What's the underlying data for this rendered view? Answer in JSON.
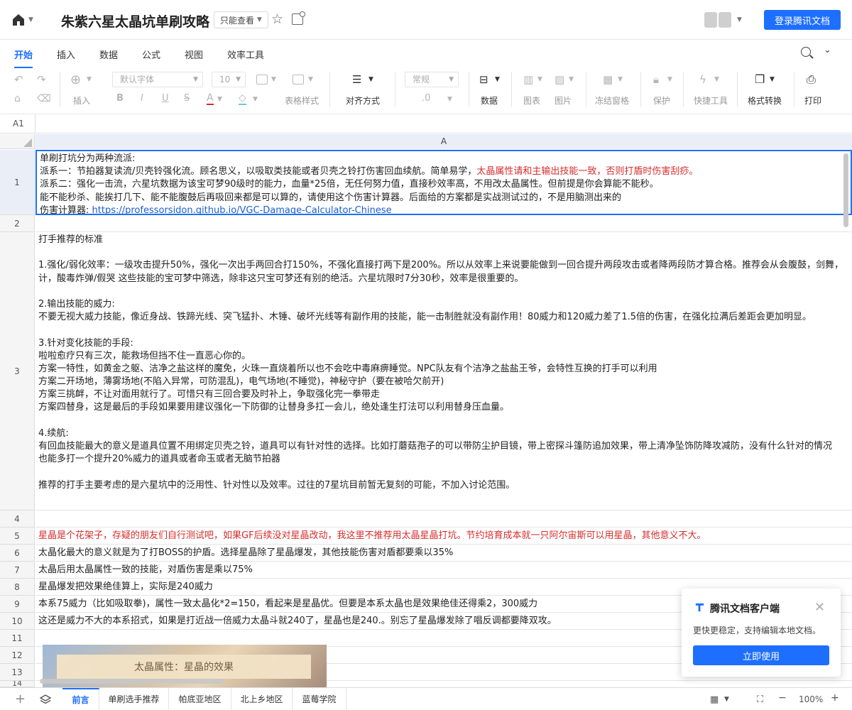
{
  "header": {
    "title": "朱紫六星太晶坑单刷攻略",
    "permission": "只能查看",
    "login_label": "登录腾讯文档"
  },
  "menu": {
    "tabs": [
      "开始",
      "插入",
      "数据",
      "公式",
      "视图",
      "效率工具"
    ]
  },
  "toolbar": {
    "font_family": "默认字体",
    "font_size": "10",
    "number_format": "常规",
    "decimal": ".0",
    "labels": {
      "insert": "插入",
      "table_style": "表格样式",
      "align": "对齐方式",
      "data": "数据",
      "chart": "图表",
      "image": "图片",
      "freeze": "冻结窗格",
      "protect": "保护",
      "quick_tools": "快捷工具",
      "format_convert": "格式转换",
      "print": "打印"
    }
  },
  "namebar": {
    "cell_ref": "A1"
  },
  "grid": {
    "column_header": "A",
    "row_numbers": [
      "1",
      "2",
      "3",
      "4",
      "5",
      "6",
      "7",
      "8",
      "9",
      "10",
      "11",
      "12",
      "13",
      "14"
    ],
    "row1": {
      "l1": "单刷打坑分为两种流派:",
      "l2a": "派系一：节拍器复读流/贝壳铃强化流。顾名思义，以吸取类技能或者贝壳之铃打伤害回血续航。简单易学，",
      "l2b": "太晶属性请和主输出技能一致，否则打盾时伤害刮痧。",
      "l3": "派系二：强化一击流，六星坑数据为该宝可梦90级时的能力，血量*25倍，无任何努力值，直接秒效率高，不用改太晶属性。但前提是你会算能不能秒。",
      "l4": "能不能秒杀、能挨打几下、能不能腹鼓后再吸回来都是可以算的，请使用这个伤害计算器。后面给的方案都是实战测试过的，不是用脑测出来的",
      "l5a": "伤害计算器: ",
      "l5b": "https://professorsidon.github.io/VGC-Damage-Calculator-Chinese"
    },
    "row3": [
      "打手推荐的标准",
      "",
      "1.强化/弱化效率：一级攻击提升50%，强化一次出手两回合打150%，不强化直接打两下是200%。所以从效率上来说要能做到一回合提升两段攻击或者降两段防才算合格。推荐会从会腹鼓，剑舞，",
      "计，酸毒炸弹/假哭 这些技能的宝可梦中筛选，除非这只宝可梦还有别的绝活。六星坑限时7分30秒，效率是很重要的。",
      "",
      "2.输出技能的威力:",
      "不要无视大威力技能，像近身战、铁蹄光线、突飞猛扑、木锤、破坏光线等有副作用的技能，能一击制胜就没有副作用！80威力和120威力差了1.5倍的伤害，在强化拉满后差距会更加明显。",
      "",
      "3.针对变化技能的手段:",
      "啦啦愈疗只有三次，能救场但挡不住一直恶心你的。",
      "方案一特性，如黄金之躯、洁净之盐这样的魔免，火珠一直烧着所以也不会吃中毒麻痹睡觉。NPC队友有个洁净之盐盐王爷，会特性互换的打手可以利用",
      "方案二开场地，薄雾场地(不陷入异常，可防混乱)，电气场地(不睡觉)，神秘守护（要在被哈欠前开)",
      "方案三挑衅，不让对面用就行了。可惜只有三回合要及时补上，争取强化完一拳带走",
      "方案四替身，这是最后的手段如果要用建议强化一下防御的让替身多扛一会儿，绝处逢生打法可以利用替身压血量。",
      "",
      "4.续航:",
      "有回血技能最大的意义是道具位置不用绑定贝壳之铃，道具可以有针对性的选择。比如打蘑菇孢子的可以带防尘护目镜，带上密探斗篷防追加效果，带上清净坠饰防降攻减防，没有什么针对的情况",
      "也能多打一个提升20%威力的道具或者命玉或者无脑节拍器",
      "",
      "推荐的打手主要考虑的是六星坑中的泛用性、针对性以及效率。过往的7星坑目前暂无复刻的可能，不加入讨论范围。"
    ],
    "row5": "星晶是个花架子，存疑的朋友们自行测试吧，如果GF后续没对星晶改动，我这里不推荐用太晶星晶打坑。节约培育成本就一只阿尔宙斯可以用星晶，其他意义不大。",
    "row6": "太晶化最大的意义就是为了打BOSS的护盾。选择星晶除了星晶爆发，其他技能伤害对盾都要乘以35%",
    "row7": "太晶后用太晶属性一致的技能，对盾伤害是乘以75%",
    "row8": "星晶爆发把效果绝佳算上，实际是240威力",
    "row9": "本系75威力（比如吸取拳)，属性一致太晶化*2=150，看起来是星晶优。但要是本系太晶也是效果绝佳还得乘2，300威力",
    "row10": "这还是威力不大的本系招式，如果是打近战一倍威力太晶斗就240了，星晶也是240.。别忘了星晶爆发除了唱反调都要降双攻。",
    "embedded_image_caption": "太晶属性：星晶的效果"
  },
  "popup": {
    "title": "腾讯文档客户端",
    "description": "更快更稳定，支持编辑本地文档。",
    "button": "立即使用"
  },
  "sheets": {
    "tabs": [
      "前言",
      "单刷选手推荐",
      "帕底亚地区",
      "北上乡地区",
      "蓝莓学院"
    ],
    "zoom": "100%"
  },
  "colors": {
    "accent": "#1e6fff",
    "warning_text": "#d62c2c",
    "link": "#1a5fd0"
  }
}
